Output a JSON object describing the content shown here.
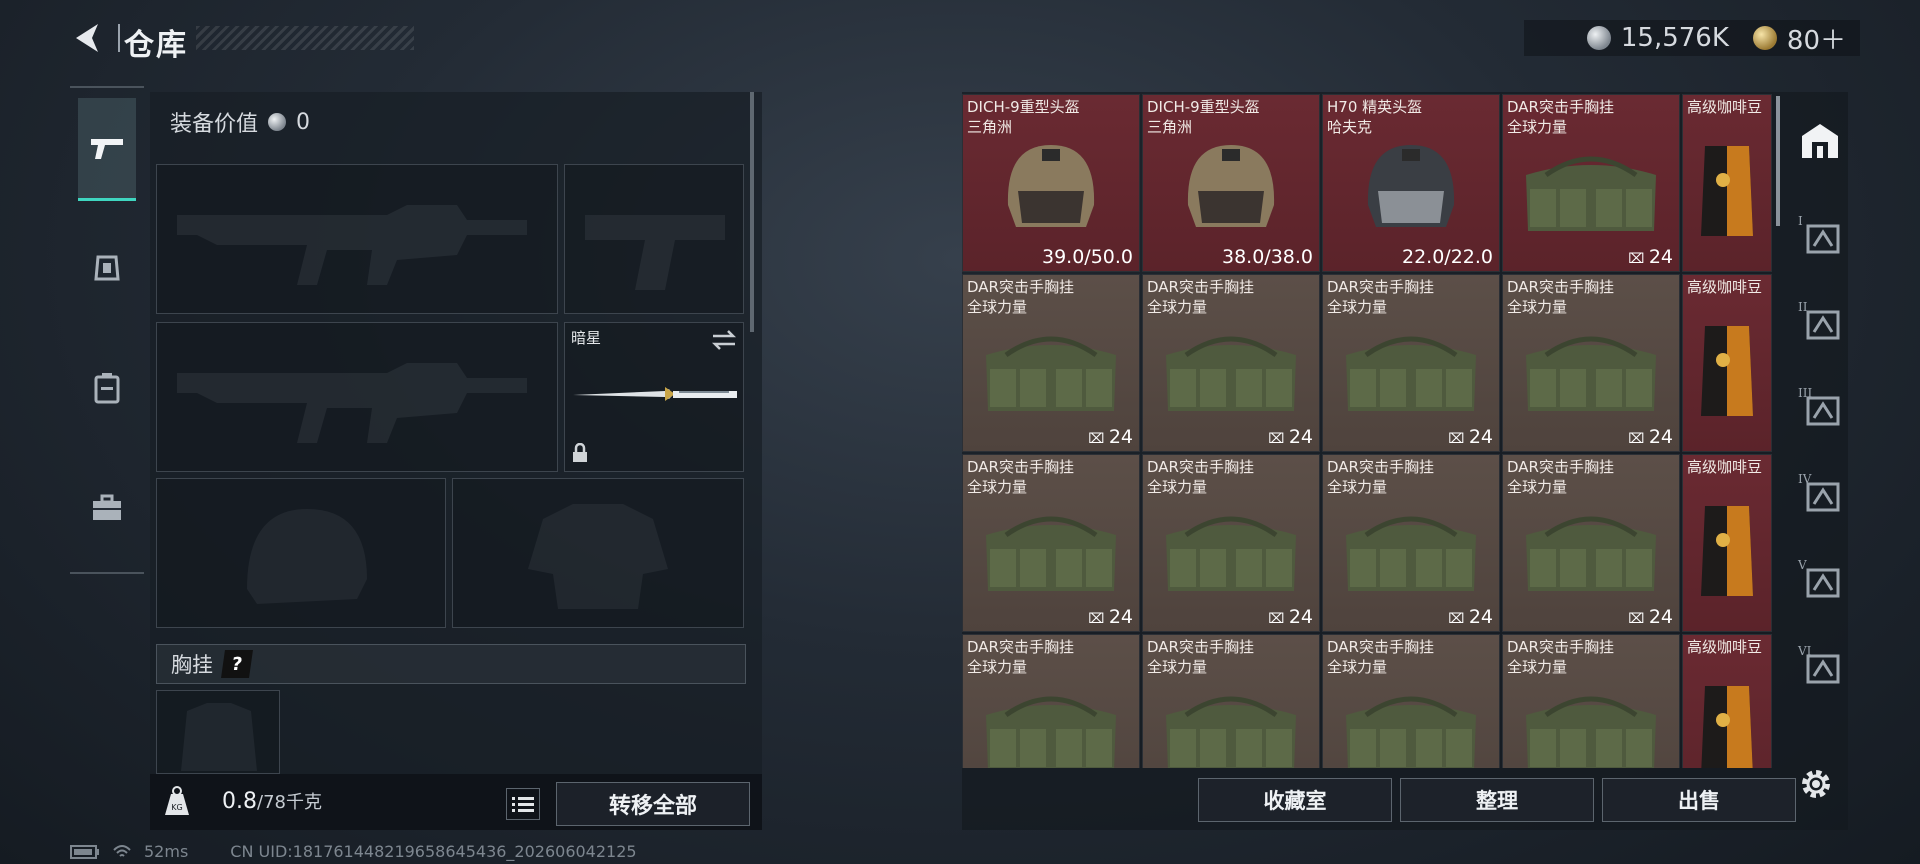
{
  "header": {
    "title": "仓库"
  },
  "currency": {
    "silver": "15,576K",
    "gold": "80＋"
  },
  "equipment": {
    "value_label": "装备价值",
    "value": "0",
    "melee_name": "暗星",
    "chest_label": "胸挂",
    "help": "?",
    "weight_current": "0.8",
    "weight_max": "/78千克",
    "transfer_all": "转移全部",
    "kg_label": "KG"
  },
  "status": {
    "ping": "52ms",
    "uid": "CN UID:18176144821965864543​6_202606042125"
  },
  "storage": {
    "buttons": [
      "收藏室",
      "整理",
      "出售"
    ],
    "rows": [
      [
        {
          "name": "DICH-9重型头盔",
          "sub": "三角洲",
          "val": "39.0/50.0",
          "color": "red",
          "kind": "helmet-tan"
        },
        {
          "name": "DICH-9重型头盔",
          "sub": "三角洲",
          "val": "38.0/38.0",
          "color": "red",
          "kind": "helmet-tan"
        },
        {
          "name": "H70 精英头盔",
          "sub": "哈夫克",
          "val": "22.0/22.0",
          "color": "red",
          "kind": "helmet-black"
        },
        {
          "name": "DAR突击手胸挂",
          "sub": "全球力量",
          "val": "24",
          "color": "red",
          "kind": "rig"
        },
        {
          "name": "高级咖啡豆",
          "sub": "",
          "val": "",
          "color": "red",
          "kind": "coffee"
        }
      ],
      [
        {
          "name": "DAR突击手胸挂",
          "sub": "全球力量",
          "val": "24",
          "color": "brown",
          "kind": "rig"
        },
        {
          "name": "DAR突击手胸挂",
          "sub": "全球力量",
          "val": "24",
          "color": "brown",
          "kind": "rig"
        },
        {
          "name": "DAR突击手胸挂",
          "sub": "全球力量",
          "val": "24",
          "color": "brown",
          "kind": "rig"
        },
        {
          "name": "DAR突击手胸挂",
          "sub": "全球力量",
          "val": "24",
          "color": "brown",
          "kind": "rig"
        },
        {
          "name": "高级咖啡豆",
          "sub": "",
          "val": "",
          "color": "red",
          "kind": "coffee"
        }
      ],
      [
        {
          "name": "DAR突击手胸挂",
          "sub": "全球力量",
          "val": "24",
          "color": "brown",
          "kind": "rig"
        },
        {
          "name": "DAR突击手胸挂",
          "sub": "全球力量",
          "val": "24",
          "color": "brown",
          "kind": "rig"
        },
        {
          "name": "DAR突击手胸挂",
          "sub": "全球力量",
          "val": "24",
          "color": "brown",
          "kind": "rig"
        },
        {
          "name": "DAR突击手胸挂",
          "sub": "全球力量",
          "val": "24",
          "color": "brown",
          "kind": "rig"
        },
        {
          "name": "高级咖啡豆",
          "sub": "",
          "val": "",
          "color": "red",
          "kind": "coffee"
        }
      ],
      [
        {
          "name": "DAR突击手胸挂",
          "sub": "全球力量",
          "val": "",
          "color": "brown",
          "kind": "rig"
        },
        {
          "name": "DAR突击手胸挂",
          "sub": "全球力量",
          "val": "",
          "color": "brown",
          "kind": "rig"
        },
        {
          "name": "DAR突击手胸挂",
          "sub": "全球力量",
          "val": "",
          "color": "brown",
          "kind": "rig"
        },
        {
          "name": "DAR突击手胸挂",
          "sub": "全球力量",
          "val": "",
          "color": "brown",
          "kind": "rig"
        },
        {
          "name": "高级咖啡豆",
          "sub": "",
          "val": "",
          "color": "red",
          "kind": "coffee"
        }
      ]
    ],
    "rail": [
      "I",
      "II",
      "III",
      "IV",
      "V",
      "VI"
    ]
  },
  "colors": {
    "accent": "#3fd6c0",
    "rare_red": "#6a2a32",
    "common_brown": "#5c4f48"
  }
}
